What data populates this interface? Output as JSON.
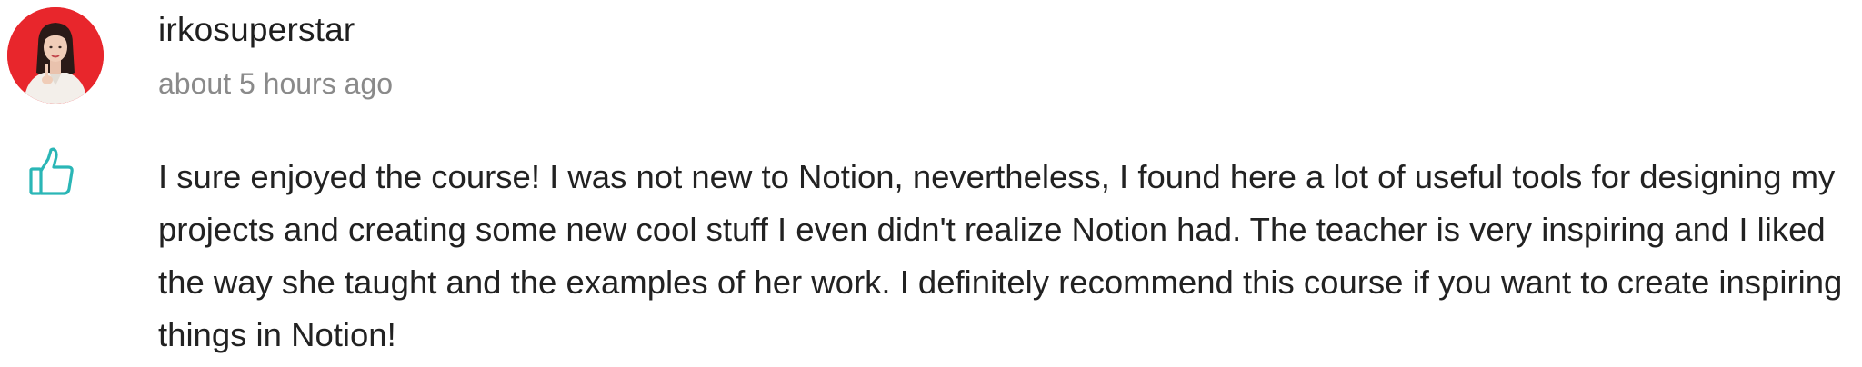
{
  "review": {
    "author": "irkosuperstar",
    "timestamp": "about 5 hours ago",
    "text": "I sure enjoyed the course! I was not new to Notion, nevertheless, I found here a lot of useful tools for designing my projects and creating some new cool stuff I even didn't realize Notion had. The teacher is very inspiring and I liked the way she taught and the examples of her work. I definitely recommend this course if you want to create inspiring things in Notion!"
  },
  "icons": {
    "avatar": "user-avatar",
    "like": "thumbs-up-icon"
  },
  "colors": {
    "avatar_background": "#e8262c",
    "like_icon": "#2ab6b6",
    "timestamp": "#8a8a8a",
    "text": "#222222"
  }
}
